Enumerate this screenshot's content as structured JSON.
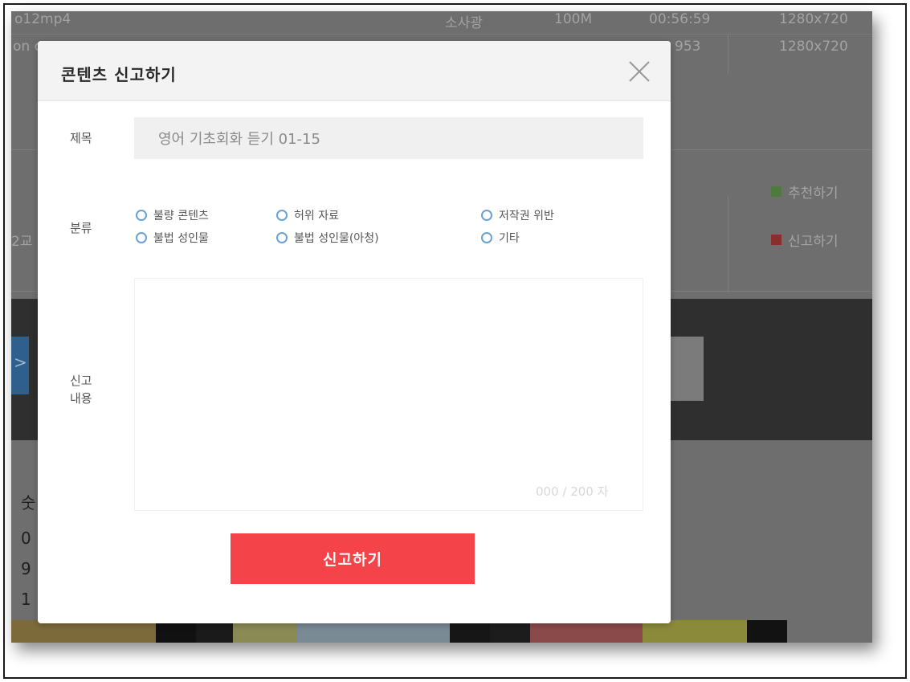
{
  "background": {
    "row1": {
      "col1": "o12mp4",
      "col2": "소사광",
      "col3": "100M",
      "col4": "00:56:59",
      "col5": "1280x720"
    },
    "row2": {
      "col1": "on c",
      "col4": "953",
      "col5": "1280x720"
    },
    "recommend_label": "추천하기",
    "report_label": "신고하기",
    "left_fragment": "2교",
    "arrow_glyph": ">",
    "left_chars": [
      "숫",
      "0",
      "9",
      "1"
    ]
  },
  "modal": {
    "title": "콘텐츠 신고하기",
    "fields": {
      "title_label": "제목",
      "title_value": "영어 기초회화 듣기 01-15",
      "category_label": "분류",
      "content_label_line1": "신고",
      "content_label_line2": "내용"
    },
    "categories": [
      "불량 콘텐츠",
      "허위 자료",
      "저작권 위반",
      "불법 성인물",
      "불법 성인물(아청)",
      "기타"
    ],
    "char_count": "000 / 200 자",
    "submit_label": "신고하기"
  },
  "colors": {
    "accent": "#f5434a",
    "radio_border": "#6aa1d8",
    "overlay": "#6e6e6e"
  }
}
